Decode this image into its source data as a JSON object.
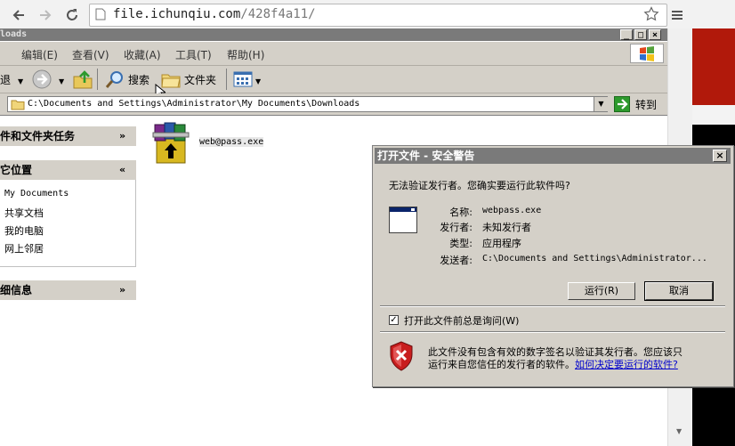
{
  "browser": {
    "url_host": "file.ichunqiu.com",
    "url_path": "/428f4a11/"
  },
  "explorer": {
    "title": "loads",
    "menu": [
      {
        "label": "编辑(E)"
      },
      {
        "label": "查看(V)"
      },
      {
        "label": "收藏(A)"
      },
      {
        "label": "工具(T)"
      },
      {
        "label": "帮助(H)"
      }
    ],
    "toolbar": {
      "back_label": "退",
      "search_label": "搜索",
      "folders_label": "文件夹"
    },
    "address": {
      "path": "C:\\Documents and Settings\\Administrator\\My Documents\\Downloads",
      "go_label": "转到"
    },
    "left_pane": {
      "tasks_header": "件和文件夹任务",
      "places_header": "它位置",
      "places": [
        "My Documents",
        "共享文档",
        "我的电脑",
        "网上邻居"
      ],
      "details_header": "细信息"
    },
    "file": {
      "name": "web@pass.exe"
    }
  },
  "dialog": {
    "title": "打开文件 - 安全警告",
    "question": "无法验证发行者。您确实要运行此软件吗?",
    "fields": [
      {
        "label": "名称:",
        "value": "webpass.exe"
      },
      {
        "label": "发行者:",
        "value": "未知发行者"
      },
      {
        "label": "类型:",
        "value": "应用程序"
      },
      {
        "label": "发送者:",
        "value": "C:\\Documents and Settings\\Administrator..."
      }
    ],
    "run_label": "运行(R)",
    "cancel_label": "取消",
    "checkbox_label": "打开此文件前总是询问(W)",
    "checkbox_checked": true,
    "warning_line1": "此文件没有包含有效的数字签名以验证其发行者。您应该只",
    "warning_line2": "运行来自您信任的发行者的软件。",
    "warning_link": "如何决定要运行的软件?"
  }
}
